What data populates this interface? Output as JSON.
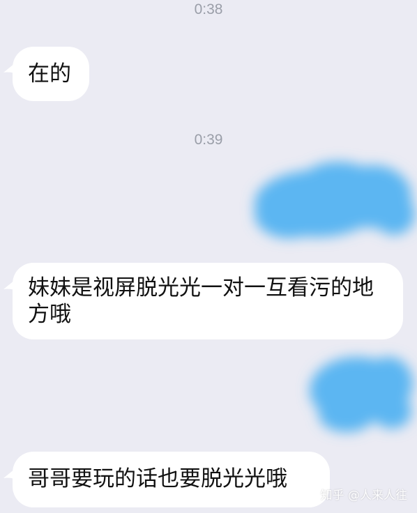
{
  "chat": {
    "messages": [
      {
        "type": "timestamp",
        "text": "0:38"
      },
      {
        "type": "incoming",
        "text": "在的"
      },
      {
        "type": "timestamp",
        "text": "0:39"
      },
      {
        "type": "outgoing",
        "text": ""
      },
      {
        "type": "incoming",
        "text": "妹妹是视屏脱光光一对一互看污的地方哦"
      },
      {
        "type": "outgoing",
        "text": ""
      },
      {
        "type": "incoming",
        "text": "哥哥要玩的话也要脱光光哦"
      }
    ]
  },
  "watermark": {
    "text": "知乎 @人来人往"
  },
  "colors": {
    "background": "#ebebf3",
    "incoming_bubble": "#ffffff",
    "outgoing_bubble": "#5cb6f2",
    "timestamp_text": "#9a9ea8"
  }
}
